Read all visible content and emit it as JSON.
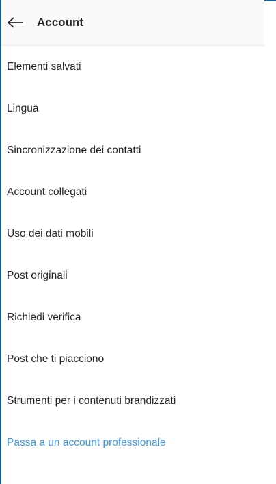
{
  "header": {
    "back_icon": "arrow-left-icon",
    "title": "Account"
  },
  "menu": {
    "items": [
      {
        "label": "Elementi salvati"
      },
      {
        "label": "Lingua"
      },
      {
        "label": "Sincronizzazione dei contatti"
      },
      {
        "label": "Account collegati"
      },
      {
        "label": "Uso dei dati mobili"
      },
      {
        "label": "Post originali"
      },
      {
        "label": "Richiedi verifica"
      },
      {
        "label": "Post che ti piacciono"
      },
      {
        "label": "Strumenti per i contenuti brandizzati"
      }
    ],
    "professional_link": "Passa a un account professionale"
  },
  "colors": {
    "link": "#3897f0",
    "text": "#262626",
    "border_accent": "#1f5d8c"
  }
}
